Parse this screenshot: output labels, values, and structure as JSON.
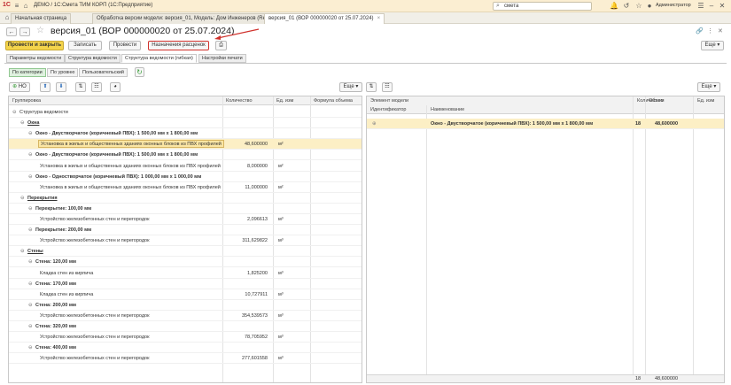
{
  "titlebar": {
    "logo": "1С",
    "title": "ДЕМО / 1С:Смета ТИМ КОРП  (1С:Предприятие)",
    "search_value": "смета",
    "user": "Администратор"
  },
  "tabs": [
    {
      "label": "Начальная страница"
    },
    {
      "label": "Обработка версии модели: версия_01, Модель: Дом Инженеров (Renga), Renga"
    },
    {
      "label": "версия_01 (ВОР 000000020 от 25.07.2024)"
    }
  ],
  "doc": {
    "title": "версия_01 (ВОР 000000020 от 25.07.2024)",
    "more_label": "Еще"
  },
  "toolbar": {
    "post_close": "Провести и закрыть",
    "write": "Записать",
    "post": "Провести",
    "assign_calc": "Назначения расценок"
  },
  "page_tabs": [
    "Параметры ведомости",
    "Структура ведомости",
    "Структура ведомости (гибкая)",
    "Настройки печати"
  ],
  "sub_tabs": [
    "По категории",
    "По уровню",
    "Пользовательский"
  ],
  "left_toolbar": {
    "no_label": "НО",
    "more_label": "Еще"
  },
  "right_toolbar": {
    "more_label": "Еще"
  },
  "left_table": {
    "headers": [
      "Группировка",
      "Количество",
      "Ед. изм",
      "Формула объема"
    ],
    "rows": [
      {
        "level": 0,
        "text": "Структура ведомости",
        "qty": "",
        "unit": "",
        "style": "normal",
        "toggle": "⊖"
      },
      {
        "level": 1,
        "text": "Окна",
        "qty": "",
        "unit": "",
        "style": "bold-ul",
        "toggle": "⊖"
      },
      {
        "level": 2,
        "text": "Окно - Двустворчатое (коричневый ПВХ): 1 500,00 мм х 1 800,00 мм",
        "qty": "",
        "unit": "",
        "style": "bold",
        "toggle": "⊖"
      },
      {
        "level": 3,
        "text": "Установка в жилых и общественных зданиях оконных блоков из ПВХ профилей",
        "qty": "48,600000",
        "unit": "м²",
        "style": "selected",
        "toggle": ""
      },
      {
        "level": 2,
        "text": "Окно - Двустворчатое (коричневый ПВХ): 1 500,00 мм х 1 800,00 мм",
        "qty": "",
        "unit": "",
        "style": "bold",
        "toggle": "⊖"
      },
      {
        "level": 3,
        "text": "Установка в жилых и общественных зданиях оконных блоков из ПВХ профилей",
        "qty": "8,000000",
        "unit": "м²",
        "style": "normal",
        "toggle": ""
      },
      {
        "level": 2,
        "text": "Окно - Одностворчатое (коричневый ПВХ): 1 000,00 мм х 1 000,00 мм",
        "qty": "",
        "unit": "",
        "style": "bold",
        "toggle": "⊖"
      },
      {
        "level": 3,
        "text": "Установка в жилых и общественных зданиях оконных блоков из ПВХ профилей",
        "qty": "11,000000",
        "unit": "м²",
        "style": "normal",
        "toggle": ""
      },
      {
        "level": 1,
        "text": "Перекрытия",
        "qty": "",
        "unit": "",
        "style": "bold-ul",
        "toggle": "⊖"
      },
      {
        "level": 2,
        "text": "Перекрытие: 100,00 мм",
        "qty": "",
        "unit": "",
        "style": "bold",
        "toggle": "⊖"
      },
      {
        "level": 3,
        "text": "Устройство железобетонных стен и перегородок",
        "qty": "2,096613",
        "unit": "м³",
        "style": "normal",
        "toggle": ""
      },
      {
        "level": 2,
        "text": "Перекрытие: 200,00 мм",
        "qty": "",
        "unit": "",
        "style": "bold",
        "toggle": "⊖"
      },
      {
        "level": 3,
        "text": "Устройство железобетонных стен и перегородок",
        "qty": "311,629822",
        "unit": "м³",
        "style": "normal",
        "toggle": ""
      },
      {
        "level": 1,
        "text": "Стены",
        "qty": "",
        "unit": "",
        "style": "bold-ul",
        "toggle": "⊖"
      },
      {
        "level": 2,
        "text": "Стена: 120,00 мм",
        "qty": "",
        "unit": "",
        "style": "bold",
        "toggle": "⊖"
      },
      {
        "level": 3,
        "text": "Кладка стен из кирпича",
        "qty": "1,825200",
        "unit": "м³",
        "style": "normal",
        "toggle": ""
      },
      {
        "level": 2,
        "text": "Стена: 170,00 мм",
        "qty": "",
        "unit": "",
        "style": "bold",
        "toggle": "⊖"
      },
      {
        "level": 3,
        "text": "Кладка стен из кирпича",
        "qty": "10,727911",
        "unit": "м³",
        "style": "normal",
        "toggle": ""
      },
      {
        "level": 2,
        "text": "Стена: 200,00 мм",
        "qty": "",
        "unit": "",
        "style": "bold",
        "toggle": "⊖"
      },
      {
        "level": 3,
        "text": "Устройство железобетонных стен и перегородок",
        "qty": "354,539573",
        "unit": "м³",
        "style": "normal",
        "toggle": ""
      },
      {
        "level": 2,
        "text": "Стена: 320,00 мм",
        "qty": "",
        "unit": "",
        "style": "bold",
        "toggle": "⊖"
      },
      {
        "level": 3,
        "text": "Устройство железобетонных стен и перегородок",
        "qty": "78,705952",
        "unit": "м³",
        "style": "normal",
        "toggle": ""
      },
      {
        "level": 2,
        "text": "Стена: 400,00 мм",
        "qty": "",
        "unit": "",
        "style": "bold",
        "toggle": "⊖"
      },
      {
        "level": 3,
        "text": "Устройство железобетонных стен и перегородок",
        "qty": "277,601558",
        "unit": "м³",
        "style": "normal",
        "toggle": ""
      }
    ]
  },
  "right_table": {
    "group_header": "Элемент модели",
    "headers": [
      "Идентификатор",
      "Наименование",
      "Количество",
      "Объем",
      "Ед. изм"
    ],
    "rows": [
      {
        "id": "",
        "name": "Окно - Двустворчатое (коричневый ПВХ): 1 500,00 мм х 1 800,00 мм",
        "qty": "18",
        "volume": "48,600000",
        "unit": ""
      }
    ],
    "footer": {
      "qty": "18",
      "volume": "48,600000"
    }
  },
  "colors": {
    "primary_button": "#f4d44b",
    "highlight": "#d0322d",
    "selection": "#fcefc5"
  }
}
